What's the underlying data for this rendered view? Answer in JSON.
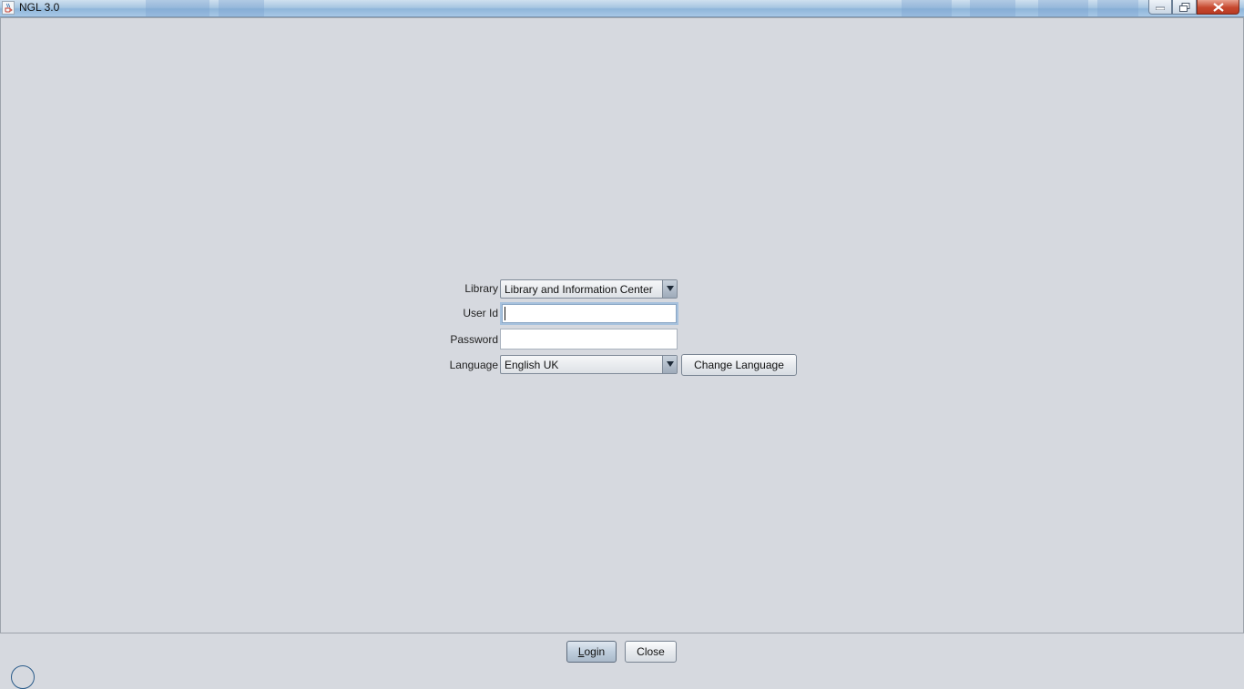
{
  "window": {
    "title": "NGL 3.0",
    "icons": [
      "java-cup-icon",
      "minimize-icon",
      "maximize-icon",
      "close-icon"
    ]
  },
  "login_form": {
    "library": {
      "label": "Library",
      "selected": "Library and Information Center"
    },
    "user_id": {
      "label": "User Id",
      "value": ""
    },
    "password": {
      "label": "Password",
      "value": ""
    },
    "language": {
      "label": "Language",
      "selected": "English UK",
      "change_button": "Change Language"
    }
  },
  "footer": {
    "login_button": {
      "mnemonic": "L",
      "rest": "ogin"
    },
    "close_button": "Close"
  },
  "colors": {
    "background": "#d6d9df",
    "close_button": "#c7492f",
    "focus_border": "#a6c1dd"
  }
}
